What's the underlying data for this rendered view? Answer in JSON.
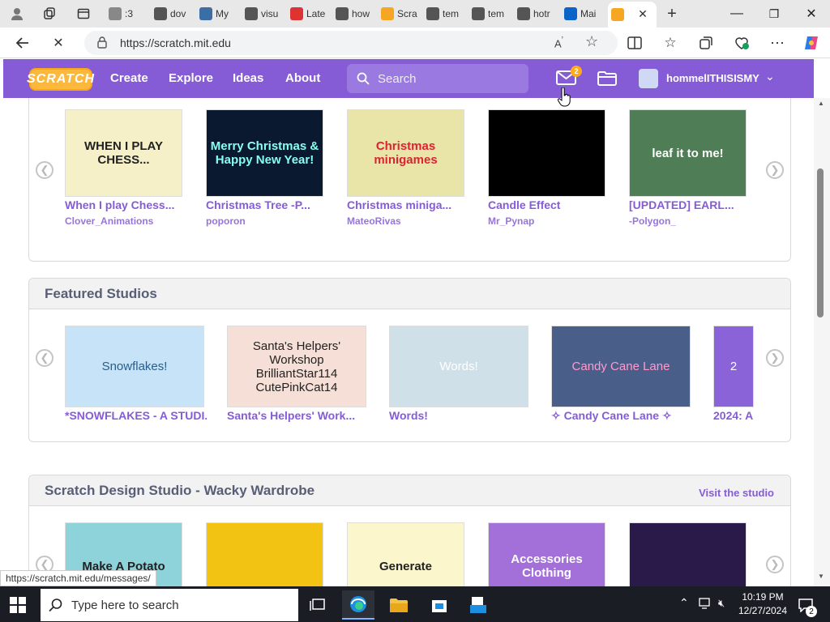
{
  "browser": {
    "tabs": [
      {
        "label": ":3",
        "fav": "#888"
      },
      {
        "label": "dov",
        "fav": "#555"
      },
      {
        "label": "My",
        "fav": "#3b6ea5"
      },
      {
        "label": "visu",
        "fav": "#555"
      },
      {
        "label": "Late",
        "fav": "#d33"
      },
      {
        "label": "how",
        "fav": "#555"
      },
      {
        "label": "Scra",
        "fav": "#f5a623"
      },
      {
        "label": "tem",
        "fav": "#555"
      },
      {
        "label": "tem",
        "fav": "#555"
      },
      {
        "label": "hotr",
        "fav": "#555"
      },
      {
        "label": "Mai",
        "fav": "#0a64c8"
      },
      {
        "label": "",
        "fav": "#f5a623"
      }
    ],
    "url": "https://scratch.mit.edu",
    "status_url": "https://scratch.mit.edu/messages/"
  },
  "nav": {
    "logo": "SCRATCH",
    "links": [
      "Create",
      "Explore",
      "Ideas",
      "About"
    ],
    "search_placeholder": "Search",
    "message_count": "2",
    "username": "hommelITHISISMY"
  },
  "projects": [
    {
      "title": "When I play Chess...",
      "author": "Clover_Animations",
      "thumb_text": "WHEN I PLAY CHESS...",
      "bg": "#f6f0c8",
      "fg": "#222"
    },
    {
      "title": "Christmas Tree -P...",
      "author": "poporon",
      "thumb_text": "Merry Christmas & Happy New Year!",
      "bg": "#0a1830",
      "fg": "#8fe"
    },
    {
      "title": "Christmas miniga...",
      "author": "MateoRivas",
      "thumb_text": "Christmas minigames",
      "bg": "#e9e4a8",
      "fg": "#d23"
    },
    {
      "title": "Candle Effect",
      "author": "Mr_Pynap",
      "thumb_text": "",
      "bg": "#000",
      "fg": "#fff"
    },
    {
      "title": "[UPDATED] EARL...",
      "author": "-Polygon_",
      "thumb_text": "leaf it to me!",
      "bg": "#4e7d56",
      "fg": "#fff"
    }
  ],
  "featured_studios": {
    "title": "Featured Studios",
    "items": [
      {
        "title": "*SNOWFLAKES - A STUDI...",
        "thumb_text": "Snowflakes!",
        "bg": "#c7e3f7",
        "fg": "#2a5d8a"
      },
      {
        "title": "Santa's Helpers' Work...",
        "thumb_text": "Santa's Helpers' Workshop BrilliantStar114 CutePinkCat14",
        "bg": "#f6dfd6",
        "fg": "#222"
      },
      {
        "title": "Words!",
        "thumb_text": "Words!",
        "bg": "#cfe0e8",
        "fg": "#fff"
      },
      {
        "title": "✧ Candy Cane Lane ✧",
        "thumb_text": "Candy Cane Lane",
        "bg": "#4a5e8a",
        "fg": "#f9c"
      },
      {
        "title": "2024: A",
        "thumb_text": "2",
        "bg": "#8a63d8",
        "fg": "#fff"
      }
    ]
  },
  "design_studio": {
    "title": "Scratch Design Studio - Wacky Wardrobe",
    "visit_label": "Visit the studio",
    "items": [
      {
        "thumb_text": "Make A Potato",
        "bg": "#8ed3d9",
        "fg": "#222"
      },
      {
        "thumb_text": "",
        "bg": "#f2c313",
        "fg": "#222"
      },
      {
        "thumb_text": "Generate",
        "bg": "#fbf6cc",
        "fg": "#222"
      },
      {
        "thumb_text": "Accessories Clothing",
        "bg": "#a36fd8",
        "fg": "#fff"
      },
      {
        "thumb_text": "",
        "bg": "#2a1a4a",
        "fg": "#fff"
      }
    ]
  },
  "taskbar": {
    "search_placeholder": "Type here to search",
    "time": "10:19 PM",
    "date": "12/27/2024",
    "notifications": "2"
  }
}
